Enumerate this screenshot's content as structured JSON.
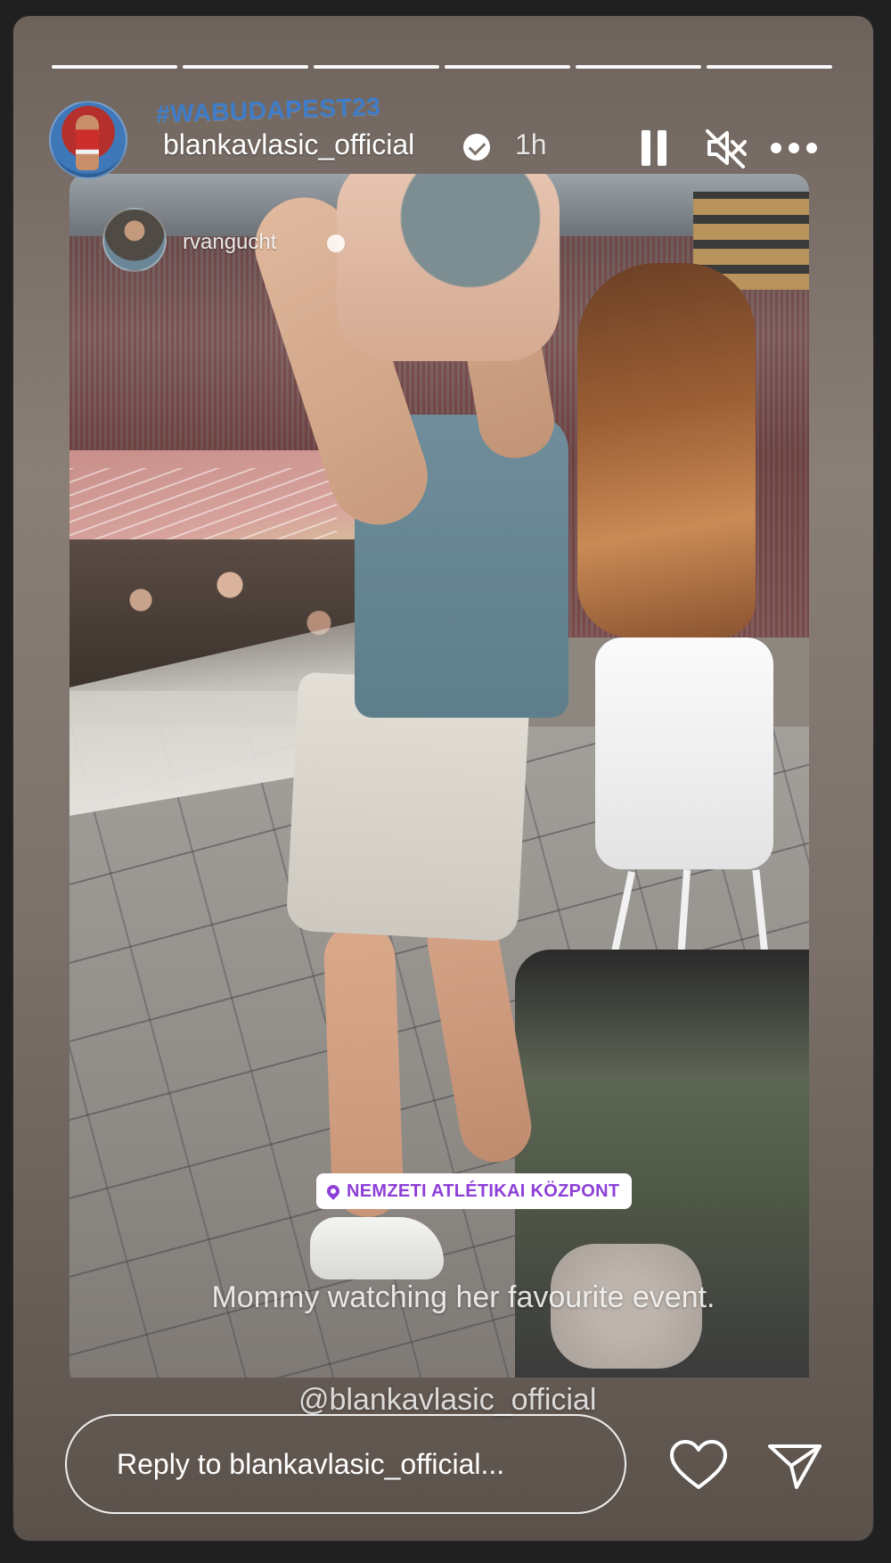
{
  "story": {
    "hashtag_sticker": "#WABUDAPEST23",
    "username": "blankavlasic_official",
    "timestamp": "1h",
    "progress_segments": 6,
    "repost_username": "rvangucht",
    "location_sticker": "NEMZETI ATLÉTIKAI KÖZPONT",
    "caption": "Mommy watching her favourite event.",
    "mention": "@blankavlasic_official",
    "reply_placeholder": "Reply to blankavlasic_official..."
  },
  "icons": {
    "verified": "verified-badge-icon",
    "pause": "pause-icon",
    "mute": "muted-speaker-icon",
    "more": "more-options-icon",
    "pin": "location-pin-icon",
    "like": "heart-icon",
    "share": "send-icon"
  },
  "colors": {
    "location_accent": "#8d3fd8",
    "hashtag_blue": "#3e7cc9"
  }
}
